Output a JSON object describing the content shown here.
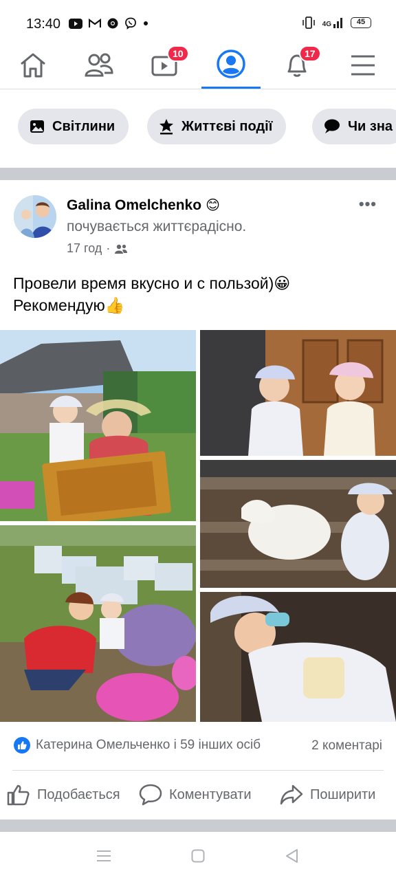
{
  "status_bar": {
    "time": "13:40",
    "network": "4G",
    "battery": "45"
  },
  "nav": {
    "items": [
      {
        "name": "home",
        "badge": ""
      },
      {
        "name": "friends",
        "badge": ""
      },
      {
        "name": "watch",
        "badge": "10"
      },
      {
        "name": "profile",
        "badge": ""
      },
      {
        "name": "notifications",
        "badge": "17"
      },
      {
        "name": "menu",
        "badge": ""
      }
    ],
    "active": "profile",
    "accent_color": "#1877f2",
    "badge_color": "#f02849"
  },
  "chips": [
    {
      "label": "Світлини",
      "icon": "photos-icon"
    },
    {
      "label": "Життєві події",
      "icon": "life-event-icon"
    },
    {
      "label": "Чи зна",
      "icon": "speech-bubble-icon"
    }
  ],
  "post": {
    "author": "Galina Omelchenko",
    "feeling_emoji": "😊",
    "feeling": "почувається життєрадісно.",
    "time": "17 год",
    "privacy_icon": "friends-icon",
    "text_line1": "Провели время вкусно и с пользой)😀",
    "text_line2": "Рекомендую👍",
    "reactions": "Катерина Омельченко і 59 інших осіб",
    "comments": "2 коментарі",
    "actions": {
      "like": "Подобається",
      "comment": "Коментувати",
      "share": "Поширити"
    }
  }
}
